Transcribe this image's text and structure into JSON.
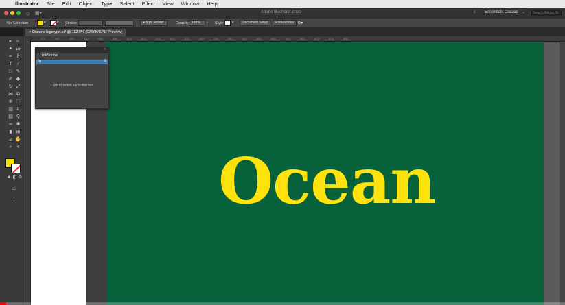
{
  "menubar": {
    "app": "Illustrator",
    "items": [
      "File",
      "Edit",
      "Object",
      "Type",
      "Select",
      "Effect",
      "View",
      "Window",
      "Help"
    ]
  },
  "appbar": {
    "title": "Adobe Illustrator 2020",
    "workspace": "Essentials Classic",
    "search_placeholder": "Search Adobe St"
  },
  "control": {
    "selection": "No Selection",
    "stroke_label": "Stroke:",
    "brush": "5 pt. Round",
    "opacity_label": "Opacity:",
    "opacity_value": "100%",
    "style_label": "Style:",
    "doc_setup": "Document Setup",
    "preferences": "Preferences"
  },
  "tab": {
    "label": "Oceans logotype.ai* @ 112.9% (CMYK/GPU Preview)"
  },
  "ruler": [
    "575",
    "580",
    "585",
    "590",
    "595",
    "600",
    "605",
    "610",
    "615",
    "620",
    "625",
    "630",
    "635",
    "640",
    "645",
    "650",
    "655",
    "660",
    "665",
    "670",
    "675",
    "680"
  ],
  "artwork": {
    "text": "Ocean",
    "color": "#fde20e",
    "background": "#07613a"
  },
  "panel": {
    "tab": "InkScribe",
    "message": "Click to select InkScribe tool"
  },
  "colors": {
    "fill": "#f5e000",
    "stroke": "#ffffff"
  }
}
